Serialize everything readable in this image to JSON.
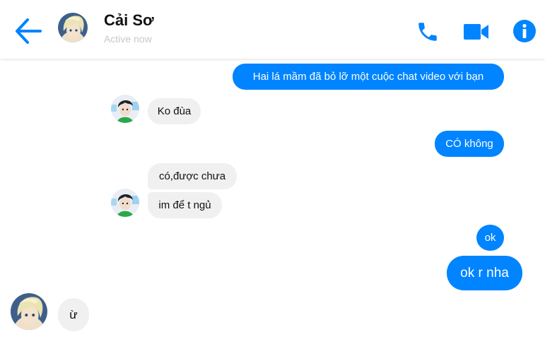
{
  "header": {
    "contact_name": "Cải Sơ",
    "status": "Active now",
    "back_icon": "arrow-left-icon",
    "call_icon": "phone-icon",
    "video_icon": "video-camera-icon",
    "info_icon": "info-icon"
  },
  "messages": [
    {
      "sender": "me",
      "text": "Hai lá mầm đã bỏ lỡ một cuộc chat video với bạn"
    },
    {
      "sender": "other",
      "text": "Ko đùa"
    },
    {
      "sender": "me",
      "text": "CÓ không"
    },
    {
      "sender": "other",
      "text": "có,được chưa"
    },
    {
      "sender": "other",
      "text": "im để t ngủ"
    },
    {
      "sender": "me",
      "text": "ok"
    },
    {
      "sender": "me",
      "text": "ok r nha"
    },
    {
      "sender": "contact",
      "text": "ừ"
    }
  ],
  "colors": {
    "accent": "#0084ff",
    "incoming_bubble": "#f0f0f0",
    "status_text": "#c8c8c8"
  }
}
